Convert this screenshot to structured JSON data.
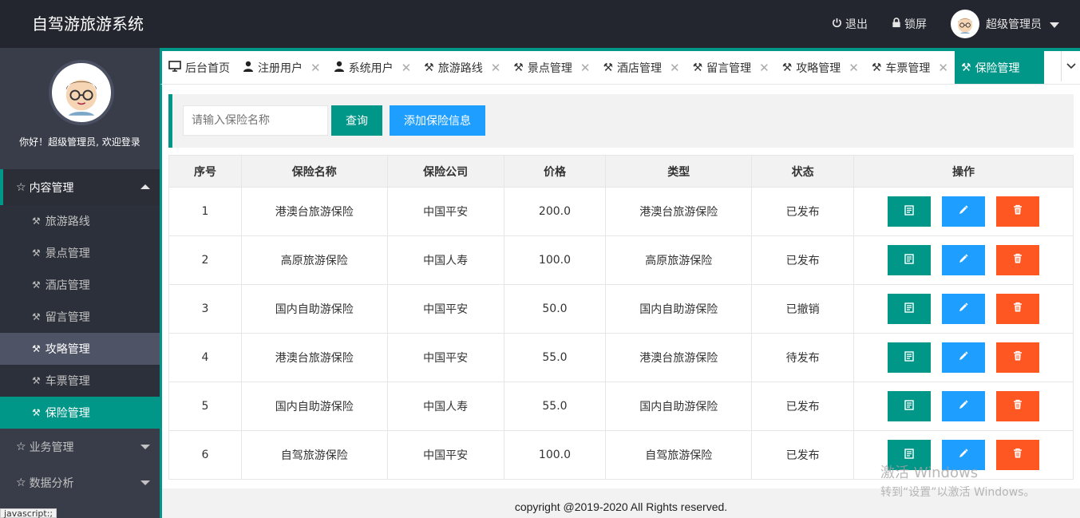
{
  "header": {
    "title": "自驾游旅游系统",
    "logout": "退出",
    "lock": "锁屏",
    "user": "超级管理员"
  },
  "sidebar": {
    "welcome": "你好！超级管理员, 欢迎登录",
    "groups": [
      {
        "label": "内容管理"
      },
      {
        "label": "业务管理"
      },
      {
        "label": "数据分析"
      }
    ],
    "items": [
      {
        "label": "旅游路线"
      },
      {
        "label": "景点管理"
      },
      {
        "label": "酒店管理"
      },
      {
        "label": "留言管理"
      },
      {
        "label": "攻略管理"
      },
      {
        "label": "车票管理"
      },
      {
        "label": "保险管理"
      }
    ]
  },
  "tabs": [
    {
      "label": "后台首页"
    },
    {
      "label": "注册用户"
    },
    {
      "label": "系统用户"
    },
    {
      "label": "旅游路线"
    },
    {
      "label": "景点管理"
    },
    {
      "label": "酒店管理"
    },
    {
      "label": "留言管理"
    },
    {
      "label": "攻略管理"
    },
    {
      "label": "车票管理"
    },
    {
      "label": "保险管理"
    }
  ],
  "search": {
    "placeholder": "请输入保险名称",
    "query_label": "查询",
    "add_label": "添加保险信息"
  },
  "table": {
    "headers": [
      "序号",
      "保险名称",
      "保险公司",
      "价格",
      "类型",
      "状态",
      "操作"
    ],
    "rows": [
      [
        "1",
        "港澳台旅游保险",
        "中国平安",
        "200.0",
        "港澳台旅游保险",
        "已发布"
      ],
      [
        "2",
        "高原旅游保险",
        "中国人寿",
        "100.0",
        "高原旅游保险",
        "已发布"
      ],
      [
        "3",
        "国内自助游保险",
        "中国平安",
        "50.0",
        "国内自助游保险",
        "已撤销"
      ],
      [
        "4",
        "港澳台旅游保险",
        "中国平安",
        "55.0",
        "港澳台旅游保险",
        "待发布"
      ],
      [
        "5",
        "国内自助游保险",
        "中国人寿",
        "55.0",
        "国内自助游保险",
        "已发布"
      ],
      [
        "6",
        "自驾旅游保险",
        "中国平安",
        "100.0",
        "自驾旅游保险",
        "已发布"
      ]
    ]
  },
  "footer": "copyright @2019-2020 All Rights reserved.",
  "status_tip": "javascript:;",
  "watermark": {
    "line1": "激活 Windows",
    "line2": "转到“设置”以激活 Windows。"
  },
  "colors": {
    "header_bg": "#23262e",
    "sidebar_bg": "#393d49",
    "accent": "#009688",
    "blue": "#1e9fff",
    "orange": "#ff5722"
  }
}
